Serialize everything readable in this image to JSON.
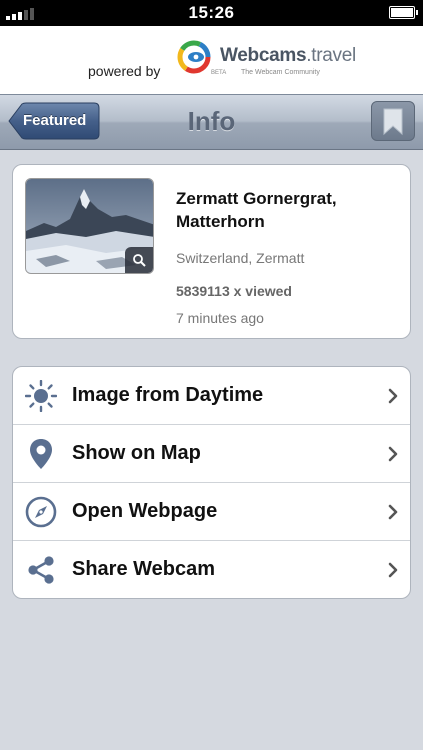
{
  "status_bar": {
    "time": "15:26"
  },
  "banner": {
    "powered_by": "powered by",
    "brand_bold": "Webcams",
    "brand_light": ".travel",
    "tagline": "The Webcam Community",
    "beta": "BETA"
  },
  "nav": {
    "back_label": "Featured",
    "title": "Info",
    "bookmark_icon": "bookmark-icon"
  },
  "webcam": {
    "name": "Zermatt Gornergrat, Matterhorn",
    "location": "Switzerland, Zermatt",
    "views": "5839113 x viewed",
    "updated": "7 minutes ago"
  },
  "actions": [
    {
      "label": "Image from Daytime",
      "icon": "sun-icon"
    },
    {
      "label": "Show on Map",
      "icon": "map-pin-icon"
    },
    {
      "label": "Open Webpage",
      "icon": "compass-icon"
    },
    {
      "label": "Share Webcam",
      "icon": "share-icon"
    }
  ],
  "colors": {
    "nav_gradient_top": "#d2d9e3",
    "nav_gradient_bottom": "#8e9aab",
    "back_button": "#3c5a84",
    "icon_blue": "#5a6f90",
    "background": "#d5d9e0"
  }
}
